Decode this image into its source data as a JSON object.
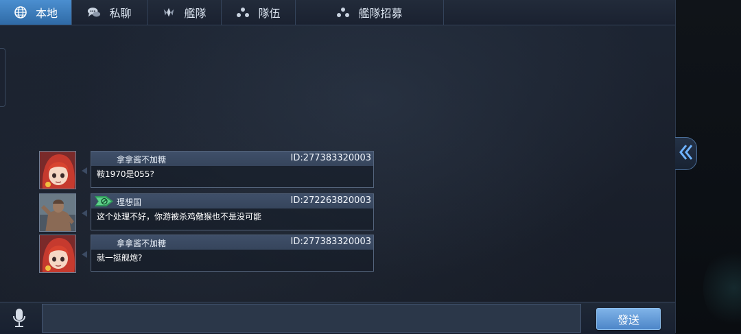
{
  "tabs": [
    {
      "label": "本地",
      "icon": "globe-icon",
      "active": true
    },
    {
      "label": "私聊",
      "icon": "chat-bubbles-icon",
      "active": false
    },
    {
      "label": "艦隊",
      "icon": "fleet-emblem-icon",
      "active": false
    },
    {
      "label": "隊伍",
      "icon": "team-dots-icon",
      "active": false
    },
    {
      "label": "艦隊招募",
      "icon": "recruit-dots-icon",
      "active": false
    }
  ],
  "messages": [
    {
      "name": "拿拿酱不加糖",
      "id": "ID:277383320003",
      "text": "鞍1970是055?",
      "avatar": "red-hair-character-avatar"
    },
    {
      "name": "理想国",
      "id": "ID:272263820003",
      "text": "这个处理不好，你游被杀鸡儆猴也不是没可能",
      "avatar": "muscular-character-avatar",
      "badge": "green-rank-badge"
    },
    {
      "name": "拿拿酱不加糖",
      "id": "ID:277383320003",
      "text": "就一挺舰炮?",
      "avatar": "red-hair-character-avatar"
    }
  ],
  "input": {
    "value": "",
    "placeholder": ""
  },
  "send_label": "發送",
  "colors": {
    "active_tab": "#3b7fc4",
    "accent": "#5d9ad9",
    "panel": "#1a2130"
  }
}
